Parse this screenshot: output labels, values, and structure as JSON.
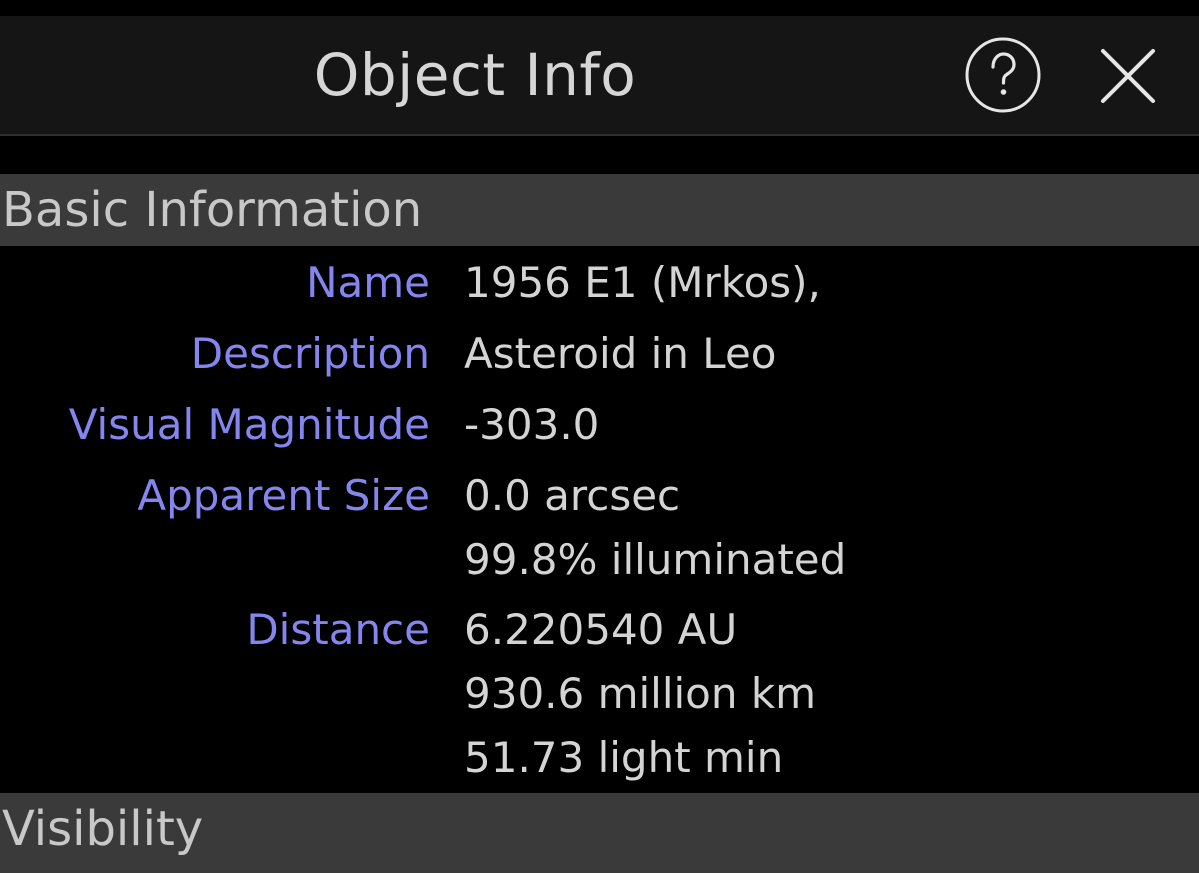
{
  "header": {
    "title": "Object Info",
    "help_icon": "question-circle-icon",
    "close_icon": "close-x-icon"
  },
  "sections": {
    "basic": {
      "title": "Basic Information",
      "rows": [
        {
          "label": "Name",
          "values": [
            "1956 E1 (Mrkos),"
          ]
        },
        {
          "label": "Description",
          "values": [
            "Asteroid in Leo"
          ]
        },
        {
          "label": "Visual Magnitude",
          "values": [
            "-303.0"
          ]
        },
        {
          "label": "Apparent Size",
          "values": [
            "0.0 arcsec",
            "99.8% illuminated"
          ]
        },
        {
          "label": "Distance",
          "values": [
            "6.220540 AU",
            "930.6 million km",
            "51.73 light min"
          ]
        }
      ]
    },
    "visibility": {
      "title": "Visibility"
    }
  },
  "colors": {
    "background": "#000000",
    "header_bg": "#151515",
    "section_bg": "#3a3a3a",
    "label": "#8585ee",
    "value": "#d4d4d4"
  }
}
